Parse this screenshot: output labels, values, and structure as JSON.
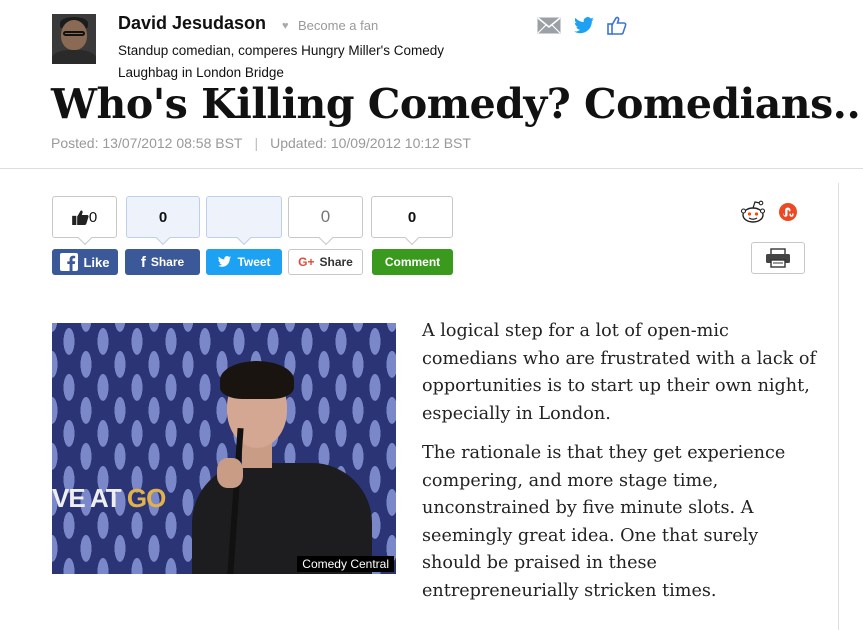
{
  "author": {
    "name": "David Jesudason",
    "fan_label": "Become a fan",
    "bio": "Standup comedian, comperes Hungry Miller's Comedy Laughbag in London Bridge"
  },
  "header_icons": [
    "mail-icon",
    "twitter-icon",
    "thumbs-up-icon"
  ],
  "article": {
    "title": "Who's Killing Comedy? Comedians...",
    "posted": "Posted: 13/07/2012 08:58 BST",
    "separator": "|",
    "updated": "Updated: 10/09/2012 10:12 BST",
    "paragraphs": [
      "A logical step for a lot of open-mic comedians who are frustrated with a lack of opportunities is to start up their own night, especially in London.",
      "The rationale is that they get experience compering, and more stage time, unconstrained by five minute slots. A seemingly great idea. One that surely should be praised in these entrepreneurially stricken times."
    ]
  },
  "share": {
    "counters": {
      "like": "0",
      "facebook": "0",
      "twitter": "",
      "google": "0",
      "comment": "0"
    },
    "buttons": {
      "like": "Like",
      "facebook": "Share",
      "tweet": "Tweet",
      "google_prefix": "G+",
      "google": "Share",
      "comment": "Comment"
    },
    "colors": {
      "facebook": "#3b5998",
      "twitter": "#1da1f2",
      "google": "#dd4b39",
      "comment": "#3a9a1e",
      "stumbleupon": "#eb4823"
    }
  },
  "image": {
    "stage_text_1": "VE AT ",
    "stage_text_2": "GO",
    "credit": "Comedy Central"
  }
}
